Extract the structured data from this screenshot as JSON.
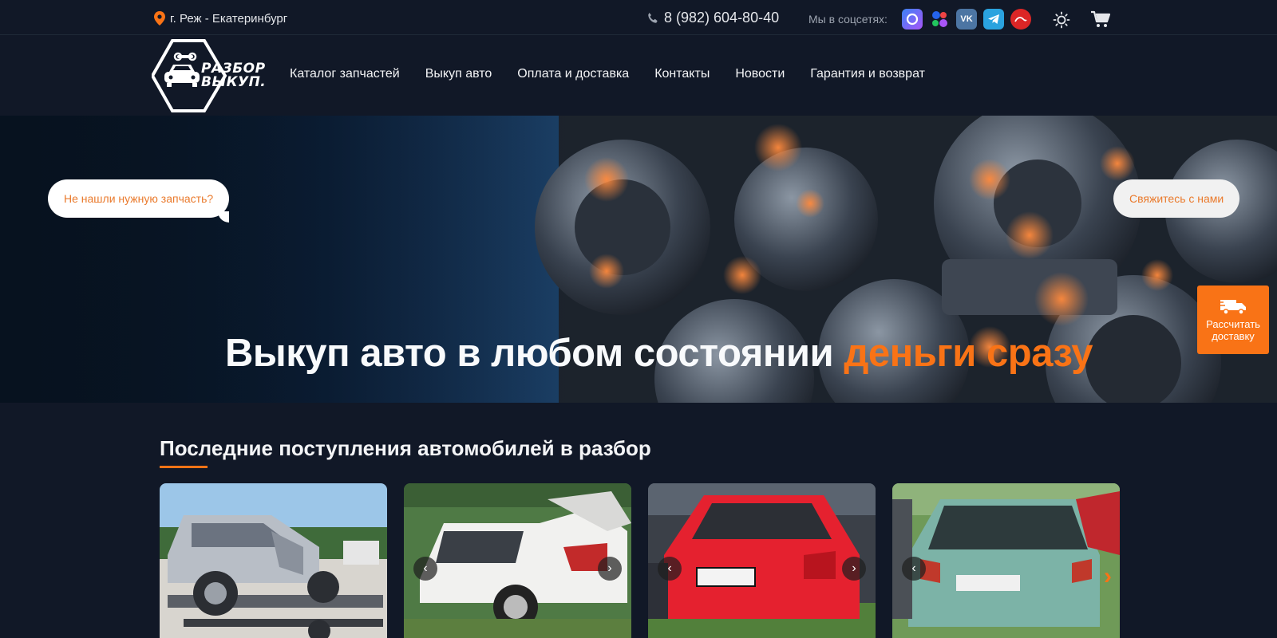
{
  "topbar": {
    "location": "г. Реж - Екатеринбург",
    "phone": "8 (982) 604-80-40",
    "social_label": "Мы в соцсетях:",
    "socials": [
      {
        "name": "max",
        "color": "#6d5dfc"
      },
      {
        "name": "dots",
        "color": "#16a34a"
      },
      {
        "name": "vk",
        "color": "#4c75a3"
      },
      {
        "name": "telegram",
        "color": "#2aa3df"
      },
      {
        "name": "avito",
        "color": "#dc2626"
      }
    ]
  },
  "logo": {
    "line1": "РАЗБОР",
    "line2": "ВЫКУП."
  },
  "nav": {
    "items": [
      {
        "label": "Каталог запчастей"
      },
      {
        "label": "Выкуп авто"
      },
      {
        "label": "Оплата и доставка"
      },
      {
        "label": "Контакты"
      },
      {
        "label": "Новости"
      },
      {
        "label": "Гарантия и возврат"
      }
    ]
  },
  "hero": {
    "title_main": "Выкуп авто в любом состоянии",
    "title_accent": "деньги сразу",
    "bubble_left": "Не нашли нужную запчасть?",
    "bubble_right": "Свяжитесь с нами"
  },
  "delivery_button": {
    "label_line1": "Рассчитать",
    "label_line2": "доставку"
  },
  "section": {
    "title": "Последние поступления автомобилей в разбор"
  },
  "cards": [
    {
      "car": "silver-suv",
      "prev": "‹",
      "next": "›"
    },
    {
      "car": "white-sedan",
      "prev": "‹",
      "next": "›"
    },
    {
      "car": "red-sedan",
      "prev": "‹",
      "next": "›"
    },
    {
      "car": "teal-hatchback",
      "prev": "‹",
      "next": "›"
    }
  ],
  "colors": {
    "accent": "#f97316",
    "background": "#111827"
  }
}
